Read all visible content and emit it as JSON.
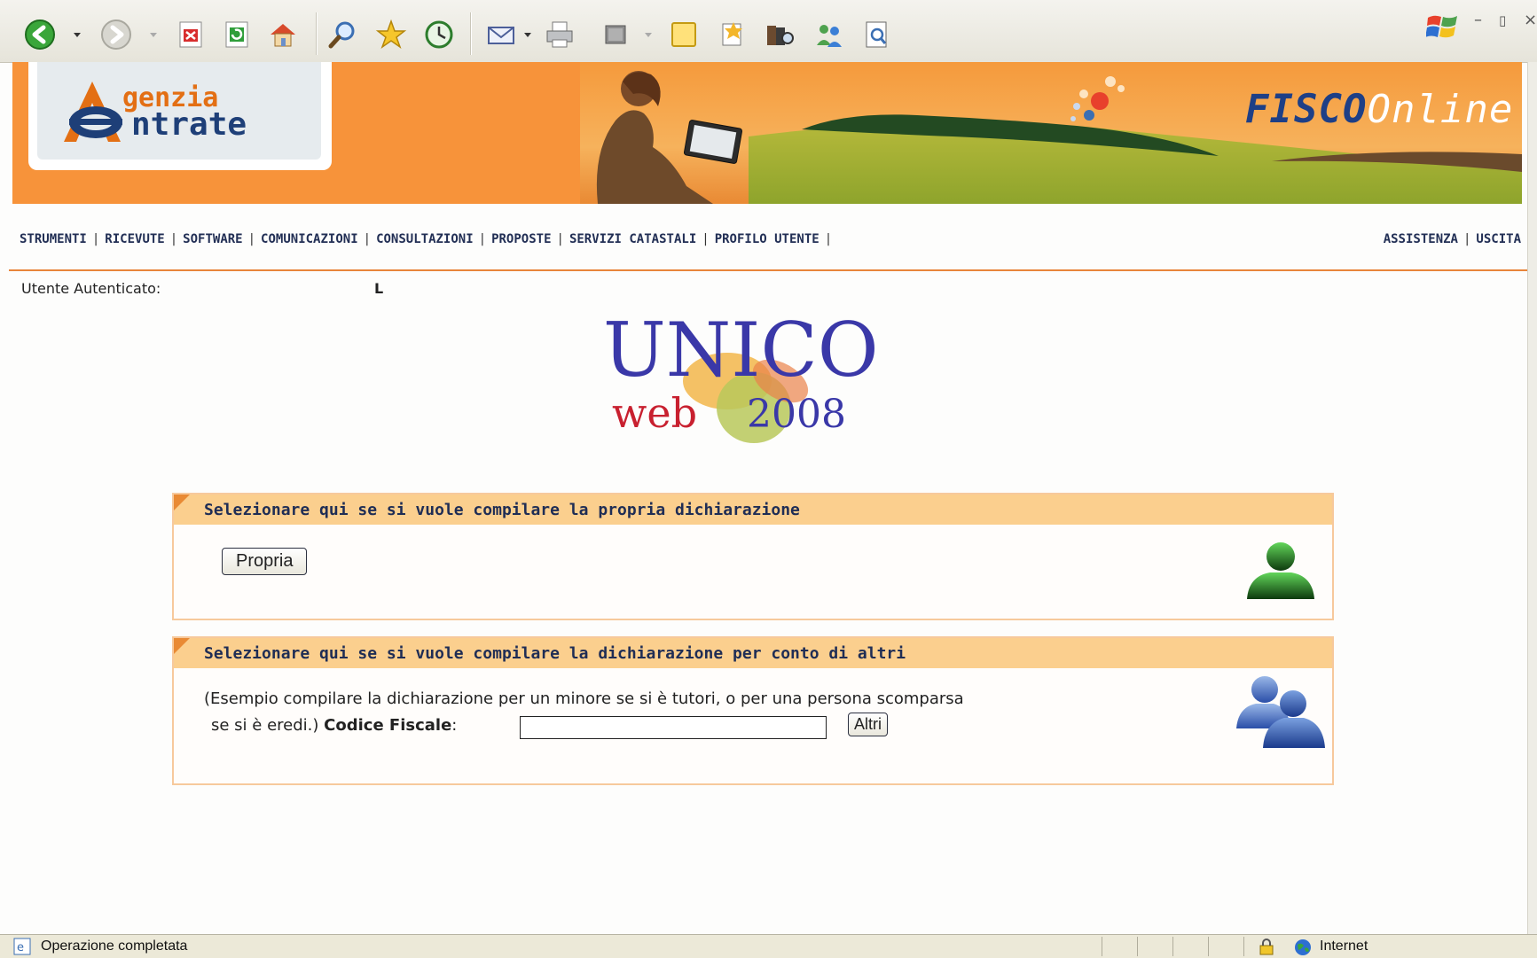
{
  "browser": {
    "toolbar_icons": [
      "back-icon",
      "forward-icon",
      "stop-icon",
      "refresh-icon",
      "home-icon",
      "search-icon",
      "favorites-icon",
      "history-icon",
      "mail-icon",
      "print-icon",
      "edit-icon",
      "discuss-icon",
      "research-icon",
      "messenger-icon",
      "related-icon"
    ]
  },
  "banner": {
    "logo_line1": "genzia",
    "logo_line2": "ntrate",
    "fisco_brand": "FISCO",
    "fisco_suffix": "nline"
  },
  "nav": {
    "items": [
      "STRUMENTI",
      "RICEVUTE",
      "SOFTWARE",
      "COMUNICAZIONI",
      "CONSULTAZIONI",
      "PROPOSTE",
      "SERVIZI CATASTALI",
      "PROFILO UTENTE"
    ],
    "right_items": [
      "ASSISTENZA",
      "USCITA"
    ],
    "separator": "|"
  },
  "user": {
    "label": "Utente Autenticato:",
    "value": "L"
  },
  "unico": {
    "title": "UNICO",
    "subtitle_web": "web",
    "subtitle_year": "2008"
  },
  "panel_own": {
    "title": "Selezionare qui se si vuole compilare la propria dichiarazione",
    "button_label": "Propria"
  },
  "panel_others": {
    "title": "Selezionare qui se si vuole compilare la dichiarazione per conto di altri",
    "description_line1": "(Esempio compilare la dichiarazione per un minore se si è tutori, o per una persona scomparsa",
    "description_line2": "se si è eredi.)",
    "codice_label": "Codice Fiscale",
    "codice_colon": ":",
    "codice_value": "",
    "button_label": "Altri"
  },
  "statusbar": {
    "text": "Operazione completata",
    "zone": "Internet"
  },
  "colors": {
    "banner_orange": "#f7933a",
    "panel_header": "#fbcf8e",
    "nav_text": "#222f55",
    "rule": "#e8853a"
  }
}
